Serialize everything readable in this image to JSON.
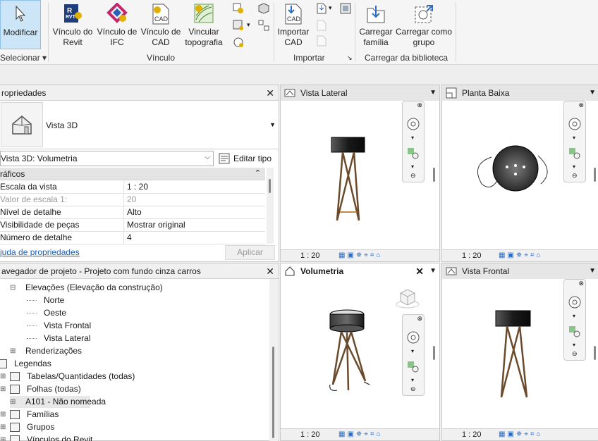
{
  "ribbon": {
    "modificar": "Modificar",
    "selecionar": "Selecionar ▾",
    "vinculo_revit": "Vínculo do Revit",
    "vinculo_ifc": "Vínculo de IFC",
    "vinculo_cad": "Vínculo de CAD",
    "vincular_topo": "Vincular topografia",
    "vinculo_group": "Vínculo",
    "importar_cad": "Importar CAD",
    "importar_group": "Importar",
    "carregar_familia": "Carregar família",
    "carregar_grupo": "Carregar como grupo",
    "biblioteca_group": "Carregar da biblioteca",
    "rvt_badge": "RVT",
    "cad_badge": "CAD"
  },
  "properties": {
    "title": "ropriedades",
    "type_name": "Vista 3D",
    "selector_value": "Vista 3D: Volumetria",
    "edit_type": "Editar tipo",
    "section": "ráficos",
    "rows": [
      {
        "k": "Escala da vista",
        "v": "1 : 20",
        "dim": false
      },
      {
        "k": "Valor de escala    1:",
        "v": "20",
        "dim": true
      },
      {
        "k": "Nível de detalhe",
        "v": "Alto",
        "dim": false
      },
      {
        "k": "Visibilidade de peças",
        "v": "Mostrar original",
        "dim": false
      },
      {
        "k": "Número de detalhe",
        "v": "4",
        "dim": false
      }
    ],
    "help_link": "juda de propriedades",
    "apply": "Aplicar"
  },
  "browser": {
    "title": "avegador de projeto - Projeto com fundo cinza carros",
    "items": [
      {
        "label": "Elevações (Elevação da construção)"
      },
      {
        "label": "Norte"
      },
      {
        "label": "Oeste"
      },
      {
        "label": "Vista Frontal"
      },
      {
        "label": "Vista Lateral"
      },
      {
        "label": "Renderizações"
      },
      {
        "label": "Legendas"
      },
      {
        "label": "Tabelas/Quantidades (todas)"
      },
      {
        "label": "Folhas (todas)"
      },
      {
        "label": "A101 - Não nomeada"
      },
      {
        "label": "Famílias"
      },
      {
        "label": "Grupos"
      },
      {
        "label": "Vínculos do Revit"
      }
    ]
  },
  "views": {
    "lateral": {
      "title": "Vista Lateral",
      "scale": "1 : 20"
    },
    "planta": {
      "title": "Planta Baixa",
      "scale": "1 : 20"
    },
    "volumetria": {
      "title": "Volumetria",
      "scale": "1 : 20"
    },
    "frontal": {
      "title": "Vista Frontal",
      "scale": "1 : 20"
    }
  },
  "colors": {
    "accent": "#cde6f7",
    "link": "#1a5fb4",
    "wood": "#6b4a2b"
  }
}
